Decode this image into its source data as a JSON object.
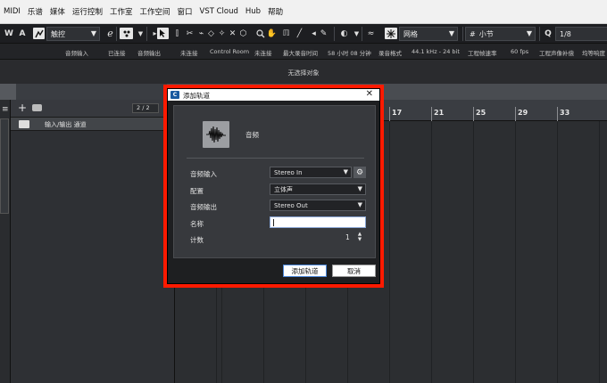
{
  "menu": [
    "MIDI",
    "乐谱",
    "媒体",
    "运行控制",
    "工作室",
    "工作空间",
    "窗口",
    "VST Cloud",
    "Hub",
    "帮助"
  ],
  "toolbar": {
    "w_label": "W",
    "a_label": "A",
    "automation_mode": "触控",
    "grid_type": "网格",
    "grid_value": "小节",
    "quantize": "1/8",
    "hash_glyph": "#",
    "q_label": "Q"
  },
  "status": {
    "audio_in_label": "音频输入",
    "audio_in_value": "已连接",
    "audio_out_label": "音频输出",
    "audio_out_value": "未连接",
    "control_room_label": "Control Room",
    "control_room_value": "未连接",
    "max_record_label": "最大录音时间",
    "max_record_value": "58 小时 08 分钟",
    "record_format_label": "录音格式",
    "record_format_value": "44.1 kHz - 24 bit",
    "frame_rate_label": "工程帧速率",
    "frame_rate_value": "60 fps",
    "pan_law_label": "工程声像补偿",
    "pan_law_value": "均等响度"
  },
  "info_line": "无选择对象",
  "track_list": {
    "counter": "2 / 2",
    "row_label": "输入/输出 通道"
  },
  "timeline": {
    "bars": [
      "17",
      "21",
      "25",
      "29",
      "33"
    ]
  },
  "dialog": {
    "title": "添加轨道",
    "logo": "C",
    "close": "✕",
    "track_type": "音频",
    "fields": {
      "audio_input_label": "音频输入",
      "audio_input_value": "Stereo In",
      "config_label": "配置",
      "config_value": "立体声",
      "audio_output_label": "音频输出",
      "audio_output_value": "Stereo Out",
      "name_label": "名称",
      "name_value": "",
      "count_label": "计数",
      "count_value": "1"
    },
    "add_button": "添加轨道",
    "cancel_button": "取消"
  },
  "colors": {
    "highlight": "#ff1a00",
    "background": "#2a2c2f",
    "accent_blue": "#4a86d8"
  },
  "icons": [
    "settings-gear-icon",
    "waveform-icon",
    "pointer-tool-icon",
    "chevron-down-icon",
    "close-icon",
    "add-icon",
    "folder-icon"
  ]
}
